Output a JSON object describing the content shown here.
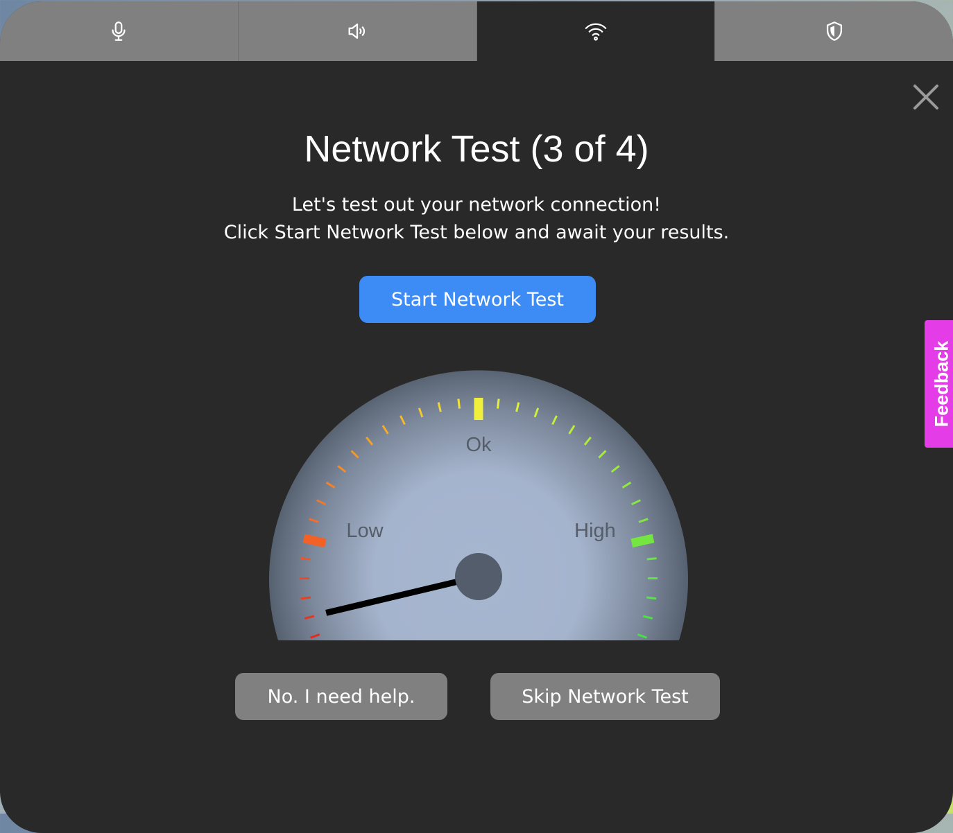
{
  "tabs": [
    {
      "icon": "microphone-icon",
      "active": false
    },
    {
      "icon": "speaker-icon",
      "active": false
    },
    {
      "icon": "wifi-icon",
      "active": true
    },
    {
      "icon": "shield-icon",
      "active": false
    }
  ],
  "dialog": {
    "title": "Network Test (3 of 4)",
    "description_line1": "Let's test out your network connection!",
    "description_line2": "Click Start Network Test below and await your results.",
    "start_button": "Start Network Test",
    "help_button": "No. I need help.",
    "skip_button": "Skip Network Test"
  },
  "gauge": {
    "labels": {
      "low": "Low",
      "ok": "Ok",
      "high": "High"
    },
    "needle_level": 0.03
  },
  "feedback": {
    "label": "Feedback"
  },
  "colors": {
    "modal_bg": "#292929",
    "tab_bg": "#808080",
    "primary": "#3d8bf5",
    "secondary_button": "#808080",
    "feedback": "#e43de8"
  }
}
